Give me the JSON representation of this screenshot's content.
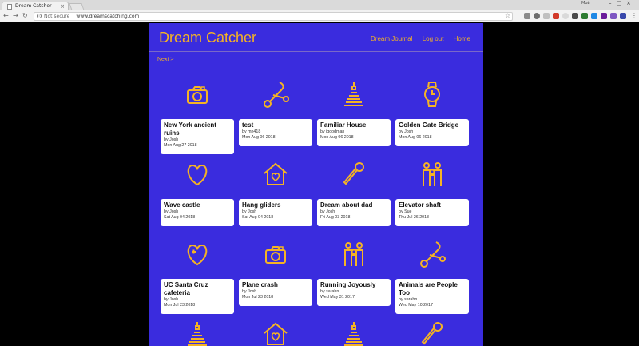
{
  "browser": {
    "tab_title": "Dream Catcher",
    "security_label": "Not secure",
    "url": "www.dreamscatching.com",
    "user_label": "Мой"
  },
  "site": {
    "title": "Dream Catcher",
    "nav": {
      "journal": "Dream Journal",
      "logout": "Log out",
      "home": "Home"
    },
    "next_label": "Next >"
  },
  "accent_color": "#f5b324",
  "background_color": "#3a2cde",
  "dreams": [
    {
      "icon": "camera-icon",
      "title": "New York ancient ruins",
      "author": "by Josh",
      "date": "Mon Aug 27 2018"
    },
    {
      "icon": "scissors-icon",
      "title": "test",
      "author": "by mn418",
      "date": "Mon Aug 06 2018"
    },
    {
      "icon": "pyramid-icon",
      "title": "Familiar House",
      "author": "by jgoodman",
      "date": "Mon Aug 06 2018"
    },
    {
      "icon": "watch-icon",
      "title": "Golden Gate Bridge",
      "author": "by Josh",
      "date": "Mon Aug 06 2018"
    },
    {
      "icon": "heart-icon",
      "title": "Wave castle",
      "author": "by Josh",
      "date": "Sat Aug 04 2018"
    },
    {
      "icon": "house-heart-icon",
      "title": "Hang gliders",
      "author": "by Josh",
      "date": "Sat Aug 04 2018"
    },
    {
      "icon": "microphone-icon",
      "title": "Dream about dad",
      "author": "by Josh",
      "date": "Fri Aug 03 2018"
    },
    {
      "icon": "family-icon",
      "title": "Elevator shaft",
      "author": "by Sue",
      "date": "Thu Jul 26 2018"
    },
    {
      "icon": "heart-plus-icon",
      "title": "UC Santa Cruz cafeteria",
      "author": "by Josh",
      "date": "Mon Jul 23 2018"
    },
    {
      "icon": "camera-icon",
      "title": "Plane crash",
      "author": "by Josh",
      "date": "Mon Jul 23 2018"
    },
    {
      "icon": "family-icon",
      "title": "Running Joyously",
      "author": "by sarahn",
      "date": "Wed May 31 2017"
    },
    {
      "icon": "scissors-icon",
      "title": "Animals are People Too",
      "author": "by sarahn",
      "date": "Wed May 10 2017"
    }
  ]
}
